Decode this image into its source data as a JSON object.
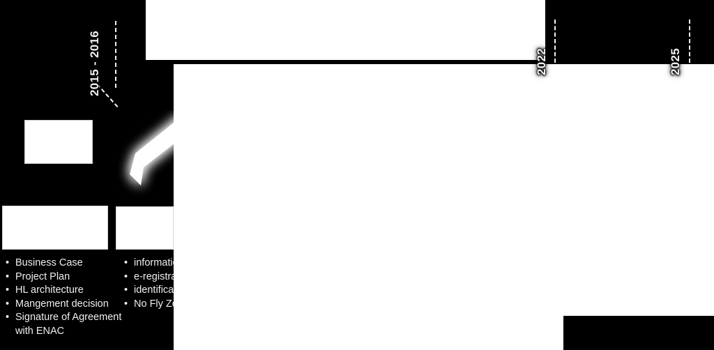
{
  "diagram": {
    "kind": "roadmap-timeline",
    "background_color": "#000000",
    "plate_color": "#ffffff",
    "text_color": "#efefef"
  },
  "timeline": {
    "axis_label": "",
    "years": [
      {
        "id": "year-2015-2016",
        "label": "2015 - 2016"
      },
      {
        "id": "year-2022",
        "label": "2022"
      },
      {
        "id": "year-2025",
        "label": "2025"
      }
    ],
    "tick_glyphs": [
      {
        "id": "tick-a",
        "label": ""
      },
      {
        "id": "tick-b",
        "label": ""
      },
      {
        "id": "tick-c",
        "label": ""
      }
    ]
  },
  "phases": [
    {
      "id": "phase-1",
      "header": "",
      "bullets": [
        "Business Case",
        "Project Plan",
        "HL architecture",
        "Mangement decision",
        "Signature of Agreement",
        "with ENAC"
      ]
    },
    {
      "id": "phase-2",
      "header": "",
      "bullets": [
        "information",
        "e-registration",
        "identification",
        "No Fly Zone"
      ]
    }
  ],
  "markers": {
    "milestone_box_label": "",
    "glow_chevron_name": "glow-chevron-marker"
  },
  "redactions": {
    "top_banner": "",
    "main_body": "",
    "bottom_right_block": ""
  }
}
